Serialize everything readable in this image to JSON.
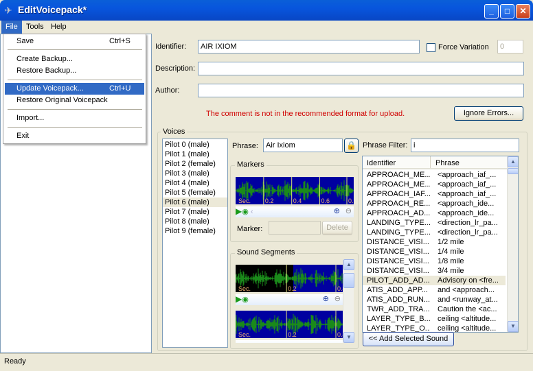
{
  "window": {
    "title": "EditVoicepack*",
    "minimize": "_",
    "maximize": "□",
    "close": "✕"
  },
  "menubar": [
    "File",
    "Tools",
    "Help"
  ],
  "file_menu": [
    {
      "label": "Save",
      "shortcut": "Ctrl+S"
    },
    {
      "label": "Create Backup..."
    },
    {
      "label": "Restore Backup..."
    },
    {
      "label": "Update Voicepack...",
      "shortcut": "Ctrl+U",
      "highlighted": true
    },
    {
      "label": "Restore Original Voicepack"
    },
    {
      "label": "Import..."
    },
    {
      "label": "Exit"
    }
  ],
  "form": {
    "identifier_label": "Identifier:",
    "identifier": "AIR IXIOM",
    "force_variation_label": "Force Variation",
    "force_variation_checked": false,
    "variation_value": "0",
    "description_label": "Description:",
    "description": "",
    "author_label": "Author:",
    "author": "",
    "warning": "The comment is not in the recommended format for upload.",
    "warning_color": "#d00000",
    "ignore_errors": "Ignore Errors..."
  },
  "voices": {
    "title": "Voices",
    "pilots": [
      "Pilot 0 (male)",
      "Pilot 1 (male)",
      "Pilot 2 (female)",
      "Pilot 3 (male)",
      "Pilot 4 (male)",
      "Pilot 5 (female)",
      "Pilot 6 (male)",
      "Pilot 7 (male)",
      "Pilot 8 (male)",
      "Pilot 9 (female)"
    ],
    "selected_pilot": 6,
    "phrase_label": "Phrase:",
    "phrase": "Air Ixiom",
    "markers_title": "Markers",
    "marker_label": "Marker:",
    "marker_value": "",
    "delete": "Delete",
    "marker_ticks": [
      "Sec.",
      "0.2",
      "0.4",
      "0.6",
      "0."
    ],
    "segments_title": "Sound Segments",
    "segment_ticks": [
      "Sec.",
      "0.2",
      "0.4"
    ],
    "filter_label": "Phrase Filter:",
    "filter": "i",
    "columns": [
      "Identifier",
      "Phrase"
    ],
    "rows": [
      [
        "APPROACH_ME...",
        "<approach_iaf_..."
      ],
      [
        "APPROACH_ME...",
        "<approach_iaf_..."
      ],
      [
        "APPROACH_IAF...",
        "<approach_iaf_..."
      ],
      [
        "APPROACH_RE...",
        "<approach_ide..."
      ],
      [
        "APPROACH_AD...",
        "<approach_ide..."
      ],
      [
        "LANDING_TYPE...",
        "<direction_lr_pa..."
      ],
      [
        "LANDING_TYPE...",
        "<direction_lr_pa..."
      ],
      [
        "DISTANCE_VISI...",
        "1/2 mile"
      ],
      [
        "DISTANCE_VISI...",
        "1/4 mile"
      ],
      [
        "DISTANCE_VISI...",
        "1/8 mile"
      ],
      [
        "DISTANCE_VISI...",
        "3/4 mile"
      ],
      [
        "PILOT_ADD_AD...",
        "Advisory on <fre..."
      ],
      [
        "ATIS_ADD_APP...",
        "and <approach..."
      ],
      [
        "ATIS_ADD_RUN...",
        "and <runway_at..."
      ],
      [
        "TWR_ADD_TRA...",
        "Caution the <ac..."
      ],
      [
        "LAYER_TYPE_B...",
        "ceiling <altitude..."
      ],
      [
        "LAYER_TYPE_O...",
        "ceiling <altitude..."
      ]
    ],
    "selected_row": 11,
    "add_selected": "<< Add Selected Sound"
  },
  "status": "Ready"
}
